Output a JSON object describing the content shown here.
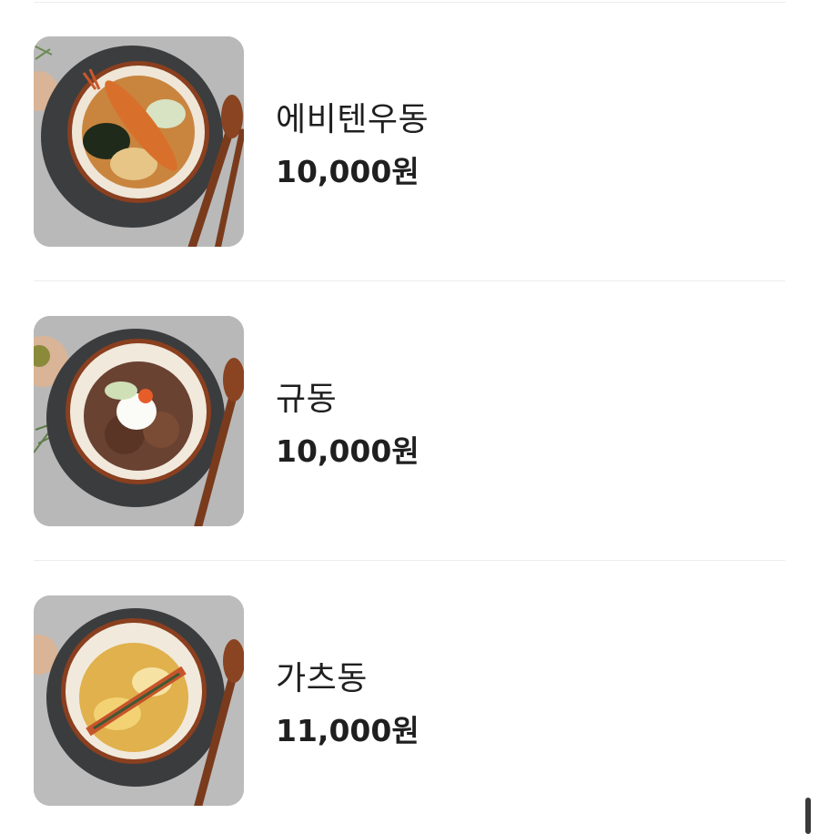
{
  "menu": {
    "items": [
      {
        "name": "에비텐우동",
        "price": "10,000원",
        "image": "ebiten-udon-photo"
      },
      {
        "name": "규동",
        "price": "10,000원",
        "image": "gyudon-photo"
      },
      {
        "name": "가츠동",
        "price": "11,000원",
        "image": "katsudon-photo"
      }
    ]
  },
  "colors": {
    "background": "#ffffff",
    "divider": "#ececec",
    "text": "#1f1f1f",
    "scrollbar": "#3a3a3a"
  }
}
